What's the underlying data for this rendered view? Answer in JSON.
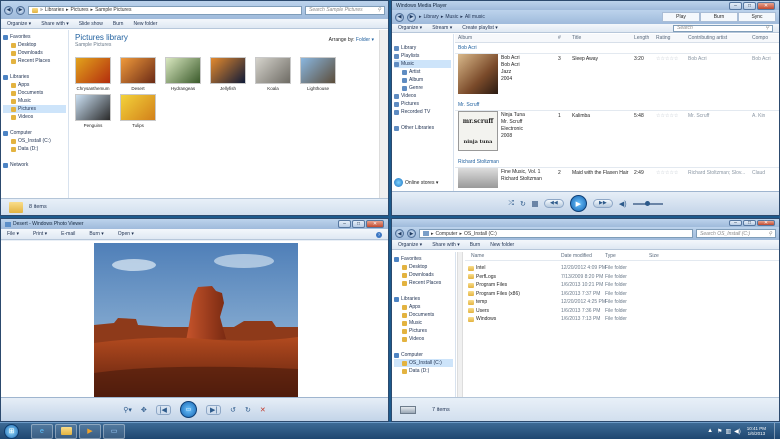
{
  "explorer1": {
    "address": [
      "Libraries",
      "Pictures",
      "Sample Pictures"
    ],
    "search_placeholder": "Search Sample Pictures",
    "commands": [
      "Organize ▾",
      "Share with ▾",
      "Slide show",
      "Burn",
      "New folder"
    ],
    "nav": [
      {
        "label": "Favorites",
        "level": 0,
        "icon": "star-icon"
      },
      {
        "label": "Desktop",
        "level": 1,
        "icon": "desktop-icon"
      },
      {
        "label": "Downloads",
        "level": 1,
        "icon": "downloads-icon"
      },
      {
        "label": "Recent Places",
        "level": 1,
        "icon": "recent-places-icon"
      },
      {
        "label": "",
        "level": 1,
        "icon": ""
      },
      {
        "label": "Libraries",
        "level": 0,
        "icon": "library-icon"
      },
      {
        "label": "Apps",
        "level": 1,
        "icon": "folder-icon"
      },
      {
        "label": "Documents",
        "level": 1,
        "icon": "documents-icon"
      },
      {
        "label": "Music",
        "level": 1,
        "icon": "music-icon"
      },
      {
        "label": "Pictures",
        "level": 1,
        "icon": "pictures-icon",
        "selected": true
      },
      {
        "label": "Videos",
        "level": 1,
        "icon": "videos-icon"
      },
      {
        "label": "",
        "level": 1,
        "icon": ""
      },
      {
        "label": "Computer",
        "level": 0,
        "icon": "computer-icon"
      },
      {
        "label": "OS_Install (C:)",
        "level": 1,
        "icon": "drive-icon"
      },
      {
        "label": "Data (D:)",
        "level": 1,
        "icon": "drive-icon"
      },
      {
        "label": "",
        "level": 1,
        "icon": ""
      },
      {
        "label": "Network",
        "level": 0,
        "icon": "network-icon"
      }
    ],
    "heading": "Pictures library",
    "subheading": "Sample Pictures",
    "arrange_label": "Arrange by:",
    "arrange_value": "Folder ▾",
    "pictures": [
      {
        "name": "Chrysanthemum",
        "c1": "#e2a31c",
        "c2": "#b32d0e"
      },
      {
        "name": "Desert",
        "c1": "#f09a3b",
        "c2": "#6b2a16"
      },
      {
        "name": "Hydrangeas",
        "c1": "#d9e8c0",
        "c2": "#3a5a2a"
      },
      {
        "name": "Jellyfish",
        "c1": "#e48a2e",
        "c2": "#0f1a38"
      },
      {
        "name": "Koala",
        "c1": "#d5d3cc",
        "c2": "#6e6b64"
      },
      {
        "name": "Lighthouse",
        "c1": "#8ab7e0",
        "c2": "#5c4d3a"
      },
      {
        "name": "Penguins",
        "c1": "#cbe0f3",
        "c2": "#2a2a2a"
      },
      {
        "name": "Tulips",
        "c1": "#f3d23a",
        "c2": "#d2801a"
      }
    ],
    "status": "8 items"
  },
  "wmp": {
    "title": "Windows Media Player",
    "breadcrumb": [
      "Library",
      "Music",
      "All music"
    ],
    "tabs": [
      "Play",
      "Burn",
      "Sync"
    ],
    "commands": [
      "Organize ▾",
      "Stream ▾",
      "Create playlist ▾"
    ],
    "search_placeholder": "Search",
    "nav": [
      {
        "label": "Library",
        "level": 0
      },
      {
        "label": "Playlists",
        "level": 0
      },
      {
        "label": "Music",
        "level": 0,
        "selected": true
      },
      {
        "label": "Artist",
        "level": 1
      },
      {
        "label": "Album",
        "level": 1
      },
      {
        "label": "Genre",
        "level": 1
      },
      {
        "label": "Videos",
        "level": 0
      },
      {
        "label": "Pictures",
        "level": 0
      },
      {
        "label": "Recorded TV",
        "level": 0
      },
      {
        "label": "",
        "level": 0
      },
      {
        "label": "Other Libraries",
        "level": 0
      }
    ],
    "online_stores": "Online stores ▾",
    "columns": [
      "Album",
      "#",
      "Title",
      "Length",
      "Rating",
      "Contributing artist",
      "Compo"
    ],
    "albums": [
      {
        "header": "Bob Acri",
        "info": [
          "Bob Acri",
          "Bob Acri",
          "Jazz",
          "2004"
        ],
        "num": "3",
        "title": "Sleep Away",
        "length": "3:20",
        "artist": "Bob Acri",
        "composer": "Bob Acri",
        "art": "jazz"
      },
      {
        "header": "Mr. Scruff",
        "info": [
          "Ninja Tuna",
          "Mr. Scruff",
          "Electronic",
          "2008"
        ],
        "num": "1",
        "title": "Kalimba",
        "length": "5:48",
        "artist": "Mr. Scruff",
        "composer": "A. Kin",
        "art": "ninja"
      },
      {
        "header": "Richard Stoltzman",
        "info": [
          "Fine Music, Vol. 1",
          "Richard Stoltzman"
        ],
        "num": "2",
        "title": "Maid with the Flaxen Hair",
        "length": "2:49",
        "artist": "Richard Stoltzman; Slov...",
        "composer": "Claud",
        "art": "fine"
      }
    ],
    "art_text": {
      "ninja_top": "mr.scruff",
      "ninja_bottom": "ninja tuna"
    }
  },
  "photo_viewer": {
    "title": "Desert - Windows Photo Viewer",
    "menu": [
      "File ▾",
      "Print ▾",
      "E-mail",
      "Burn ▾",
      "Open ▾"
    ]
  },
  "explorer2": {
    "address": [
      "Computer",
      "OS_Install (C:)"
    ],
    "search_placeholder": "Search OS_Install (C:)",
    "commands": [
      "Organize ▾",
      "Share with ▾",
      "Burn",
      "New folder"
    ],
    "nav": [
      {
        "label": "Favorites",
        "level": 0,
        "icon": "star-icon"
      },
      {
        "label": "Desktop",
        "level": 1,
        "icon": "desktop-icon"
      },
      {
        "label": "Downloads",
        "level": 1,
        "icon": "downloads-icon"
      },
      {
        "label": "Recent Places",
        "level": 1,
        "icon": "recent-places-icon"
      },
      {
        "label": "",
        "level": 1,
        "icon": ""
      },
      {
        "label": "Libraries",
        "level": 0,
        "icon": "library-icon"
      },
      {
        "label": "Apps",
        "level": 1,
        "icon": "folder-icon"
      },
      {
        "label": "Documents",
        "level": 1,
        "icon": "documents-icon"
      },
      {
        "label": "Music",
        "level": 1,
        "icon": "music-icon"
      },
      {
        "label": "Pictures",
        "level": 1,
        "icon": "pictures-icon"
      },
      {
        "label": "Videos",
        "level": 1,
        "icon": "videos-icon"
      },
      {
        "label": "",
        "level": 1,
        "icon": ""
      },
      {
        "label": "Computer",
        "level": 0,
        "icon": "computer-icon"
      },
      {
        "label": "OS_Install (C:)",
        "level": 1,
        "icon": "drive-icon",
        "selected": true
      },
      {
        "label": "Data (D:)",
        "level": 1,
        "icon": "drive-icon"
      }
    ],
    "columns": [
      "Name",
      "Date modified",
      "Type",
      "Size"
    ],
    "files": [
      {
        "name": "Intel",
        "date": "12/20/2012 4:09 PM",
        "type": "File folder"
      },
      {
        "name": "PerfLogs",
        "date": "7/13/2009 8:20 PM",
        "type": "File folder"
      },
      {
        "name": "Program Files",
        "date": "1/6/2013 10:21 PM",
        "type": "File folder"
      },
      {
        "name": "Program Files (x86)",
        "date": "1/6/2013 7:37 PM",
        "type": "File folder"
      },
      {
        "name": "temp",
        "date": "12/20/2012 4:25 PM",
        "type": "File folder"
      },
      {
        "name": "Users",
        "date": "1/6/2013 7:36 PM",
        "type": "File folder"
      },
      {
        "name": "Windows",
        "date": "1/6/2013 7:13 PM",
        "type": "File folder"
      }
    ],
    "status": "7 items"
  },
  "taskbar": {
    "time": "10:41 PM",
    "date": "1/6/2013"
  }
}
